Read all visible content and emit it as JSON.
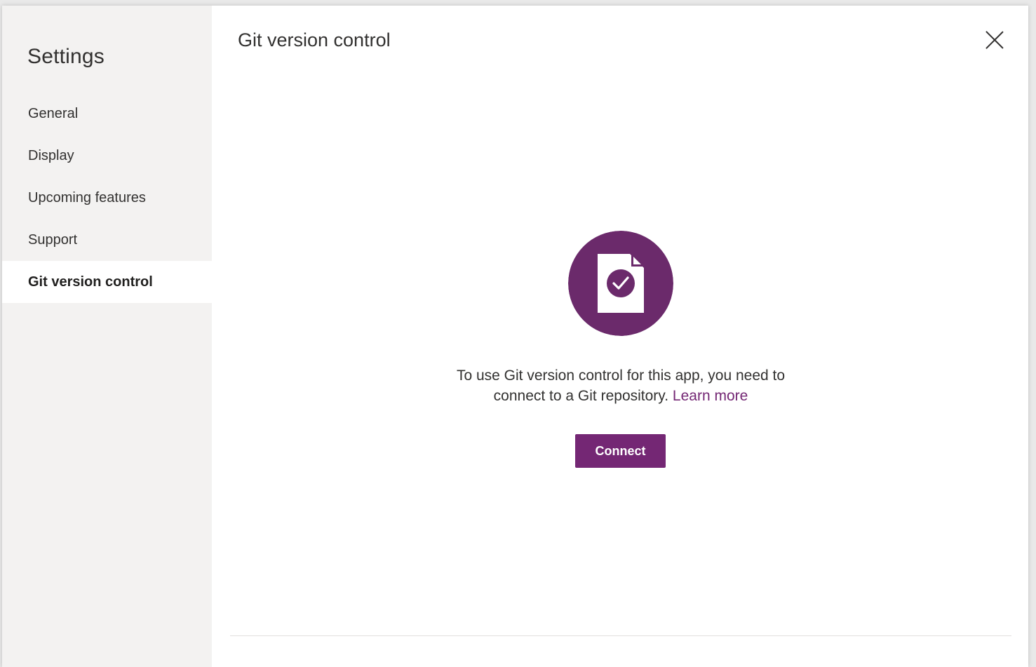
{
  "sidebar": {
    "title": "Settings",
    "items": [
      {
        "label": "General",
        "selected": false
      },
      {
        "label": "Display",
        "selected": false
      },
      {
        "label": "Upcoming features",
        "selected": false
      },
      {
        "label": "Support",
        "selected": false
      },
      {
        "label": "Git version control",
        "selected": true
      }
    ]
  },
  "header": {
    "title": "Git version control",
    "close_icon": "close-icon"
  },
  "main": {
    "icon": "document-check-icon",
    "message": "To use Git version control for this app, you need to connect to a Git repository.",
    "link_label": "Learn more",
    "connect_label": "Connect"
  },
  "colors": {
    "accent": "#742774",
    "hero_background": "#6b2a6b",
    "sidebar_background": "#f3f2f1",
    "selected_item_background": "#ffffff",
    "text": "#323130"
  }
}
